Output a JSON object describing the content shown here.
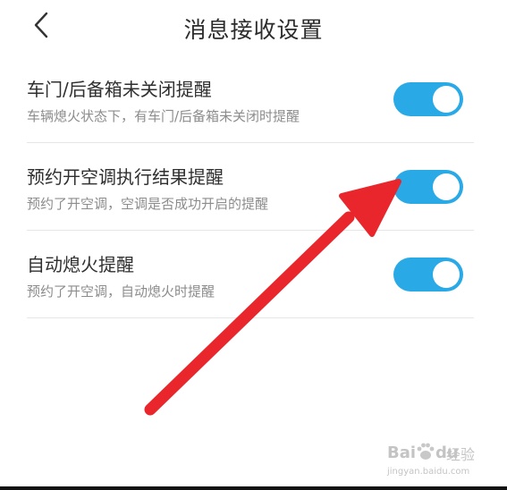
{
  "header": {
    "title": "消息接收设置",
    "back_icon": "chevron-left-icon"
  },
  "settings": [
    {
      "title": "车门/后备箱未关闭提醒",
      "description": "车辆熄火状态下，有车门/后备箱未关闭时提醒",
      "enabled": true
    },
    {
      "title": "预约开空调执行结果提醒",
      "description": "预约了开空调，空调是否成功开启的提醒",
      "enabled": true
    },
    {
      "title": "自动熄火提醒",
      "description": "预约了开空调，自动熄火时提醒",
      "enabled": true
    }
  ],
  "colors": {
    "toggle_on": "#29a9e6",
    "annotation_arrow": "#e8262b"
  },
  "watermark": {
    "brand_left": "Bai",
    "brand_right": "du",
    "brand_cn": "经验",
    "url": "jingyan.baidu.com"
  }
}
